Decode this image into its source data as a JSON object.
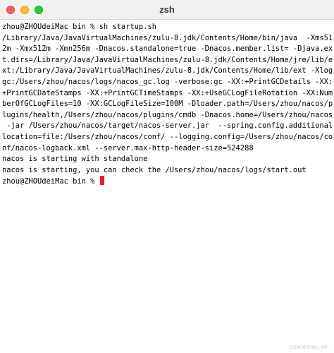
{
  "window": {
    "title": "zsh"
  },
  "terminal": {
    "lines": [
      "zhou@ZHOUdeiMac bin % sh startup.sh",
      "/Library/Java/JavaVirtualMachines/zulu-8.jdk/Contents/Home/bin/java  -Xms51",
      "2m -Xmx512m -Xmn256m -Dnacos.standalone=true -Dnacos.member.list= -Djava.ex",
      "t.dirs=/Library/Java/JavaVirtualMachines/zulu-8.jdk/Contents/Home/jre/lib/e",
      "xt:/Library/Java/JavaVirtualMachines/zulu-8.jdk/Contents/Home/lib/ext -Xlog",
      "gc:/Users/zhou/nacos/logs/nacos_gc.log -verbose:gc -XX:+PrintGCDetails -XX:",
      "+PrintGCDateStamps -XX:+PrintGCTimeStamps -XX:+UseGCLogFileRotation -XX:Num",
      "berOfGCLogFiles=10 -XX:GCLogFileSize=100M -Dloader.path=/Users/zhou/nacos/p",
      "lugins/health,/Users/zhou/nacos/plugins/cmdb -Dnacos.home=/Users/zhou/nacos",
      " -jar /Users/zhou/nacos/target/nacos-server.jar  --spring.config.additional-",
      "location=file:/Users/zhou/nacos/conf/ --logging.config=/Users/zhou/nacos/co",
      "nf/nacos-logback.xml --server.max-http-header-size=524288",
      "nacos is starting with standalone",
      "nacos is starting, you can check the /Users/zhou/nacos/logs/start.out"
    ],
    "prompt": "zhou@ZHOUdeiMac bin % "
  },
  "watermark": "CSDN @ZHOU_VIP_"
}
